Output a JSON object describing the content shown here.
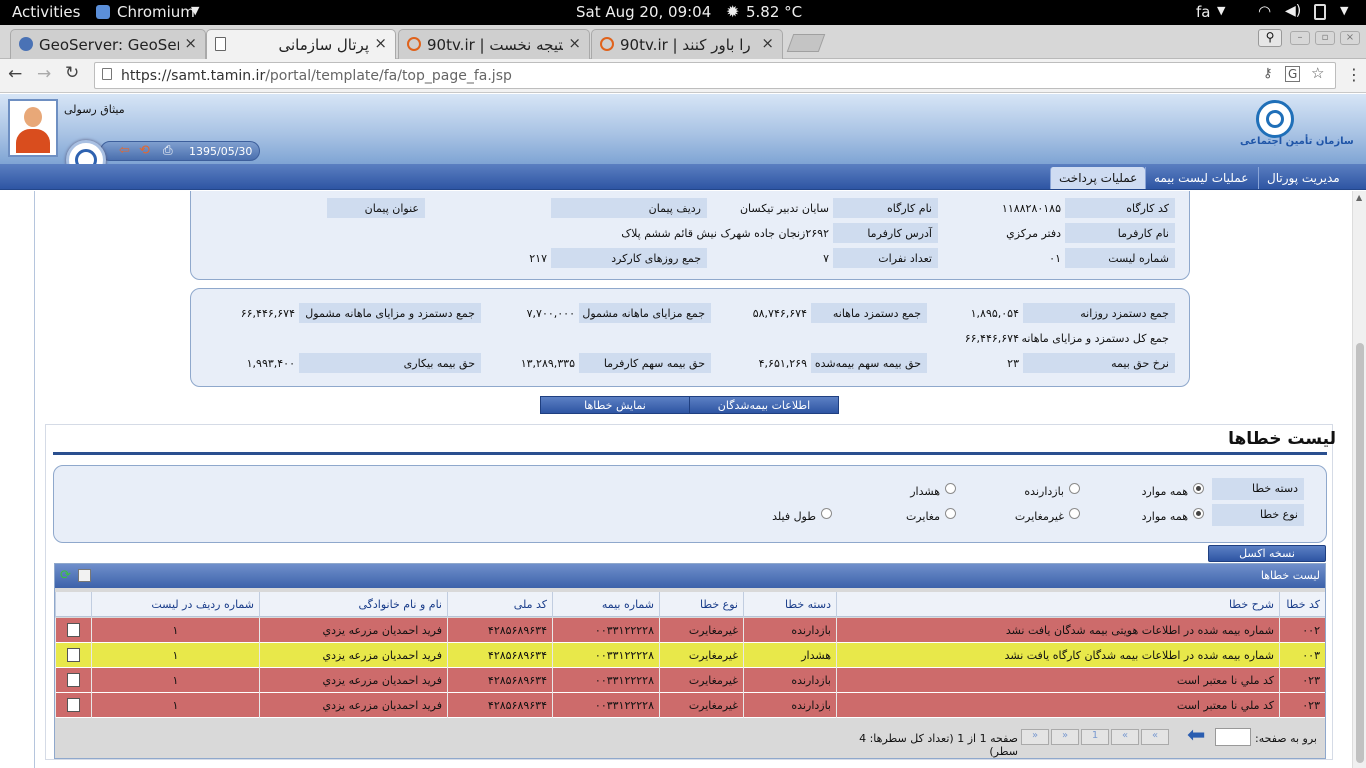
{
  "system_bar": {
    "activities": "Activities",
    "app": "Chromium",
    "clock": "Sat Aug 20, 09:04",
    "weather": "5.82 °C",
    "lang": "fa"
  },
  "tabs": [
    {
      "title": "GeoServer: GeoSer",
      "close": "×"
    },
    {
      "title": "پرتال سازمانی",
      "close": "×"
    },
    {
      "title": "90tv.ir | نتیجه نخست",
      "close": "×"
    },
    {
      "title": "90tv.ir | را باور کنند",
      "close": "×"
    }
  ],
  "address": {
    "url_host": "https://samt.tamin.ir",
    "url_path": "/portal/template/fa/top_page_fa.jsp"
  },
  "header": {
    "user_name": "میثاق رسولی",
    "date": "1395/05/30",
    "logo_text": "سازمان تأمین اجتماعی"
  },
  "menu": [
    {
      "label": "مدیریت پورتال"
    },
    {
      "label": "عملیات لیست بیمه"
    },
    {
      "label": "عملیات پرداخت"
    }
  ],
  "info": {
    "workshop_code_label": "کد کارگاه",
    "workshop_code": "۱۱۸۸۲۸۰۱۸۵",
    "workshop_name_label": "نام کارگاه",
    "workshop_name": "سایان تدبیر تیکسان",
    "contract_row_label": "ردیف پیمان",
    "contract_row": "",
    "contract_title_label": "عنوان پیمان",
    "contract_title": "",
    "employer_label": "نام کارفرما",
    "employer": "دفتر مرکزي",
    "employer_addr_label": "آدرس کارفرما",
    "employer_addr": "۲۶۹۲زنجان جاده شهرک نیش قائم ششم پلاک",
    "list_no_label": "شماره لیست",
    "list_no": "۰۱",
    "count_label": "تعداد نفرات",
    "count": "۷",
    "days_label": "جمع روزهای کارکرد",
    "days": "۲۱۷"
  },
  "summary": {
    "daily_wage_label": "جمع دستمزد روزانه",
    "daily_wage": "۱,۸۹۵,۰۵۴",
    "monthly_wage_label": "جمع دستمزد ماهانه",
    "monthly_wage": "۵۸,۷۴۶,۶۷۴",
    "benefits_label": "جمع مزایای ماهانه مشمول",
    "benefits": "۷,۷۰۰,۰۰۰",
    "wage_benefits_label": "جمع دستمزد و مزایای ماهانه مشمول",
    "wage_benefits": "۶۶,۴۴۶,۶۷۴",
    "total_label": "جمع کل دستمزد و مزایای ماهانه",
    "total": "۶۶,۴۴۶,۶۷۴",
    "rate_label": "نرخ حق بیمه",
    "rate": "۲۳",
    "insured_share_label": "حق بیمه سهم بیمه‌شده",
    "insured_share": "۴,۶۵۱,۲۶۹",
    "employer_share_label": "حق بیمه سهم کارفرما",
    "employer_share": "۱۳,۲۸۹,۳۳۵",
    "unemployment_label": "حق بیمه بیکاری",
    "unemployment": "۱,۹۹۳,۴۰۰"
  },
  "buttons": {
    "insured_info": "اطلاعات بیمه‌شدگان",
    "show_errors": "نمایش خطاها",
    "excel": "نسخه اکسل"
  },
  "errors": {
    "title": "لیست خطاها",
    "category_label": "دسته خطا",
    "type_label": "نوع خطا",
    "category_options": [
      {
        "label": "همه موارد",
        "checked": true
      },
      {
        "label": "بازدارنده",
        "checked": false
      },
      {
        "label": "هشدار",
        "checked": false
      }
    ],
    "type_options": [
      {
        "label": "همه موارد",
        "checked": true
      },
      {
        "label": "غیرمغایرت",
        "checked": false
      },
      {
        "label": "مغایرت",
        "checked": false
      },
      {
        "label": "طول فیلد",
        "checked": false
      }
    ],
    "grid_title": "لیست خطاها",
    "columns": [
      "کد خطا",
      "شرح خطا",
      "دسته خطا",
      "نوع خطا",
      "شماره بیمه",
      "کد ملی",
      "نام و نام خانوادگی",
      "شماره ردیف در لیست"
    ],
    "rows": [
      {
        "code": "۰۰۲",
        "desc": "شماره بیمه شده در اطلاعات هویتی بیمه شدگان یافت نشد",
        "cat": "بازدارنده",
        "type": "غیرمغایرت",
        "ins": "۰۰۳۳۱۲۲۲۲۸",
        "nid": "۴۲۸۵۶۸۹۶۳۴",
        "name": "فرید احمدیان مزرعه یزدي",
        "rowno": "۱",
        "color": "#cd6b6b"
      },
      {
        "code": "۰۰۳",
        "desc": "شماره بیمه شده در اطلاعات بیمه شدگان کارگاه یافت نشد",
        "cat": "هشدار",
        "type": "غیرمغایرت",
        "ins": "۰۰۳۳۱۲۲۲۲۸",
        "nid": "۴۲۸۵۶۸۹۶۳۴",
        "name": "فرید احمدیان مزرعه یزدي",
        "rowno": "۱",
        "color": "#e8e84a"
      },
      {
        "code": "۰۲۳",
        "desc": "کد ملي نا معتبر است",
        "cat": "بازدارنده",
        "type": "غیرمغایرت",
        "ins": "۰۰۳۳۱۲۲۲۲۸",
        "nid": "۴۲۸۵۶۸۹۶۳۴",
        "name": "فرید احمدیان مزرعه یزدي",
        "rowno": "۱",
        "color": "#cd6b6b"
      },
      {
        "code": "۰۲۳",
        "desc": "کد ملي نا معتبر است",
        "cat": "بازدارنده",
        "type": "غیرمغایرت",
        "ins": "۰۰۳۳۱۲۲۲۲۸",
        "nid": "۴۲۸۵۶۸۹۶۳۴",
        "name": "فرید احمدیان مزرعه یزدي",
        "rowno": "۱",
        "color": "#cd6b6b"
      }
    ],
    "pager": {
      "goto_label": "برو به صفحه:",
      "page_value": "",
      "page_info": "صفحه 1 از 1 (تعداد کل سطرها: 4 سطر)",
      "current_page": "1",
      "first": "«",
      "prev": "«",
      "next": "»",
      "last": "»"
    }
  }
}
